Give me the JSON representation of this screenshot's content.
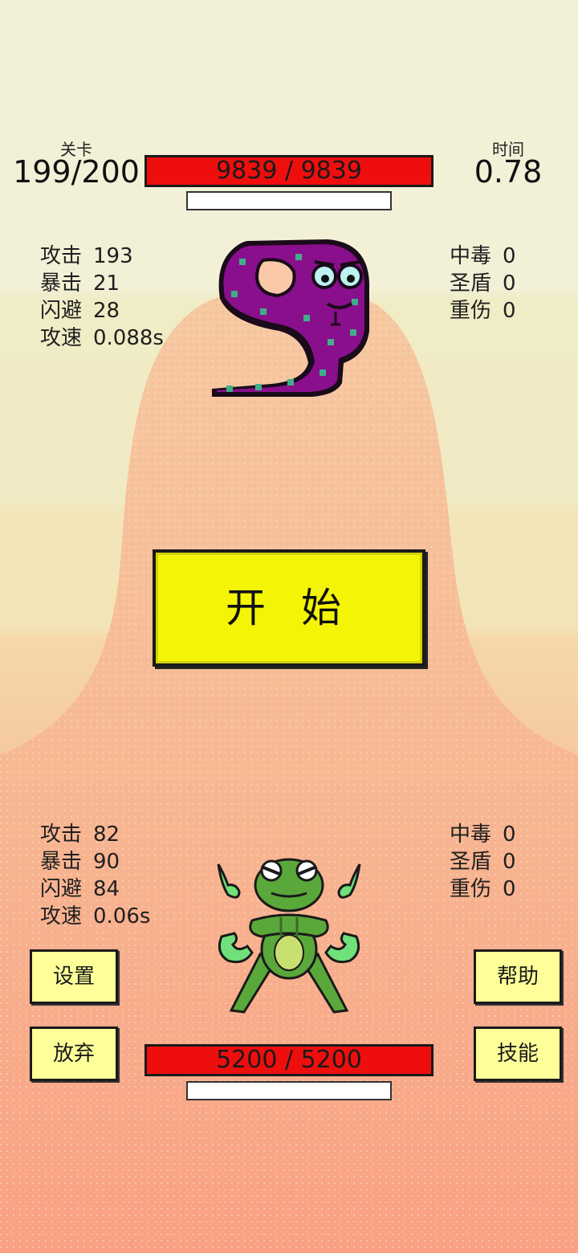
{
  "header": {
    "level_label": "关卡",
    "level_value": "199/200",
    "time_label": "时间",
    "time_value": "0.78"
  },
  "enemy": {
    "sprite_icon": "purple-snake-icon",
    "hp_text": "9839 / 9839",
    "hp_fraction": 1.0,
    "stats_left": [
      {
        "key": "攻击",
        "value": "193"
      },
      {
        "key": "暴击",
        "value": "21"
      },
      {
        "key": "闪避",
        "value": "28"
      },
      {
        "key": "攻速",
        "value": "0.088s"
      }
    ],
    "stats_right": [
      {
        "key": "中毒",
        "value": "0"
      },
      {
        "key": "圣盾",
        "value": "0"
      },
      {
        "key": "重伤",
        "value": "0"
      }
    ]
  },
  "start_button": {
    "label": "开 始"
  },
  "player": {
    "sprite_icon": "green-frog-icon",
    "hp_text": "5200 / 5200",
    "hp_fraction": 1.0,
    "stats_left": [
      {
        "key": "攻击",
        "value": "82"
      },
      {
        "key": "暴击",
        "value": "90"
      },
      {
        "key": "闪避",
        "value": "84"
      },
      {
        "key": "攻速",
        "value": "0.06s"
      }
    ],
    "stats_right": [
      {
        "key": "中毒",
        "value": "0"
      },
      {
        "key": "圣盾",
        "value": "0"
      },
      {
        "key": "重伤",
        "value": "0"
      }
    ]
  },
  "buttons": {
    "settings": "设置",
    "give_up": "放弃",
    "help": "帮助",
    "skills": "技能"
  },
  "colors": {
    "hp_bar": "#ef0e0e",
    "start_button": "#f4f406",
    "side_button": "#ffff99",
    "snake": "#8a0f8c",
    "frog": "#5aa83a"
  }
}
